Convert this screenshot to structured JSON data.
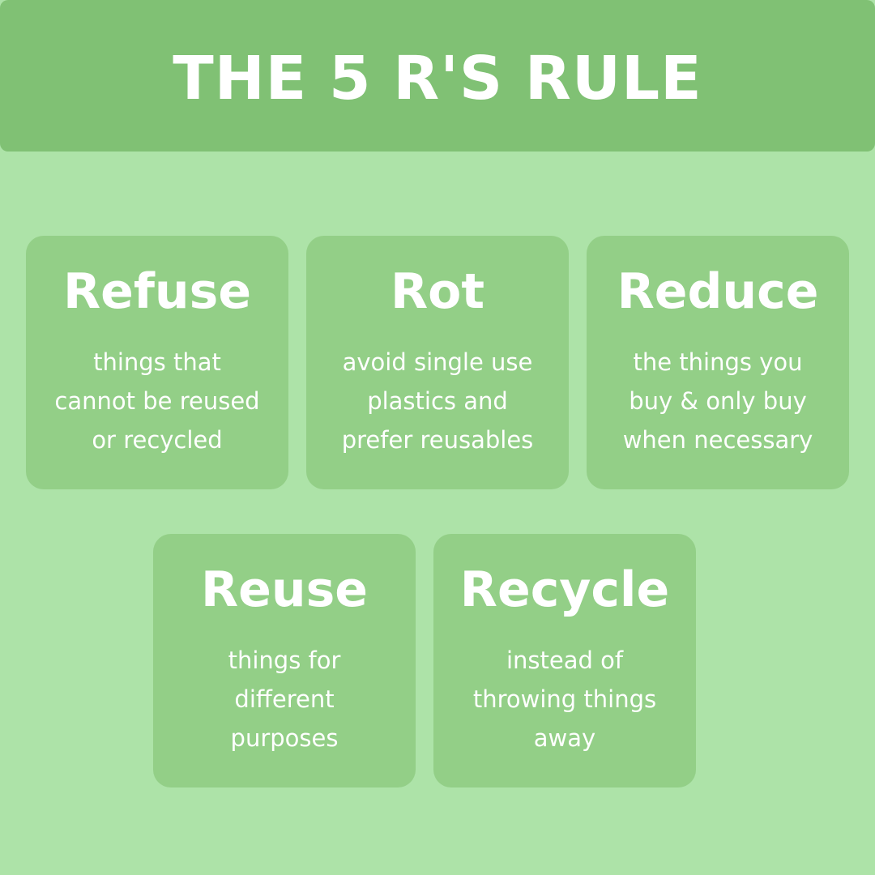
{
  "header": {
    "title": "THE 5 R'S RULE"
  },
  "cards": [
    {
      "title": "Refuse",
      "lines": [
        "things that",
        "cannot be reused",
        "or recycled"
      ]
    },
    {
      "title": "Rot",
      "lines": [
        "avoid single use",
        "plastics and",
        "prefer reusables"
      ]
    },
    {
      "title": "Reduce",
      "lines": [
        "the things you",
        "buy & only buy",
        "when necessary"
      ]
    },
    {
      "title": "Reuse",
      "lines": [
        "things for",
        "different",
        "purposes"
      ]
    },
    {
      "title": "Recycle",
      "lines": [
        "instead of",
        "throwing things",
        "away"
      ]
    }
  ],
  "colors": {
    "background": "#ade3a8",
    "header": "#80c174",
    "card": "#93cf87",
    "text": "#ffffff"
  }
}
